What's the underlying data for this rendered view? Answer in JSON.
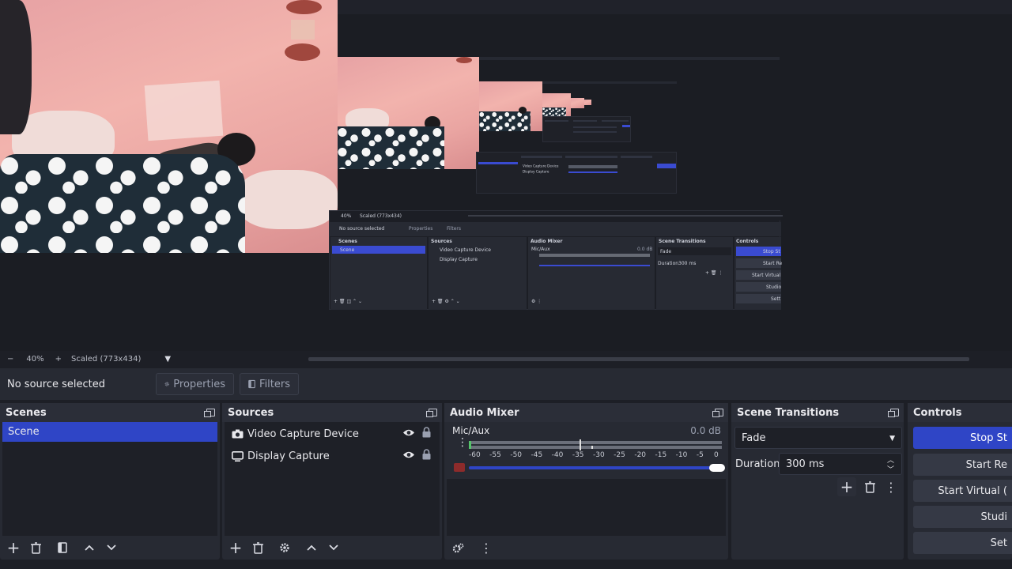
{
  "zoom": {
    "minus": "−",
    "percent": "40%",
    "plus": "+",
    "mode": "Scaled (773x434)"
  },
  "properties_bar": {
    "status": "No source selected",
    "properties_label": "Properties",
    "filters_label": "Filters"
  },
  "scenes": {
    "title": "Scenes",
    "items": [
      "Scene"
    ]
  },
  "sources": {
    "title": "Sources",
    "items": [
      {
        "label": "Video Capture Device",
        "icon": "camera-icon"
      },
      {
        "label": "Display Capture",
        "icon": "monitor-icon"
      }
    ]
  },
  "audio_mixer": {
    "title": "Audio Mixer",
    "channel": "Mic/Aux",
    "level": "0.0 dB",
    "scale": [
      "-60",
      "-55",
      "-50",
      "-45",
      "-40",
      "-35",
      "-30",
      "-25",
      "-20",
      "-15",
      "-10",
      "-5",
      "0"
    ],
    "volume_fraction": 1.0
  },
  "transitions": {
    "title": "Scene Transitions",
    "selected": "Fade",
    "duration_label": "Duration",
    "duration_value": "300 ms"
  },
  "controls": {
    "title": "Controls",
    "buttons": [
      "Stop St",
      "Start Re",
      "Start Virtual (",
      "Studi",
      "Set"
    ]
  },
  "nested_preview": {
    "status": "No source selected",
    "zoom": "40%",
    "mode": "Scaled (773x434)",
    "properties": "Properties",
    "filters": "Filters",
    "scenes": "Scenes",
    "scene_item": "Scene",
    "sources": "Sources",
    "src1": "Video Capture Device",
    "src2": "Display Capture",
    "mixer": "Audio Mixer",
    "mic": "Mic/Aux",
    "db": "0.0 dB",
    "transitions": "Scene Transitions",
    "fade": "Fade",
    "duration": "Duration",
    "ms": "300 ms",
    "controls": "Controls",
    "stop": "Stop St",
    "start_rec": "Start Re",
    "start_virtual": "Start Virtual",
    "studio": "Studio",
    "settings": "Sett"
  },
  "colors": {
    "accent": "#2f45c6",
    "panel": "#272a33",
    "background": "#1d1f26"
  }
}
